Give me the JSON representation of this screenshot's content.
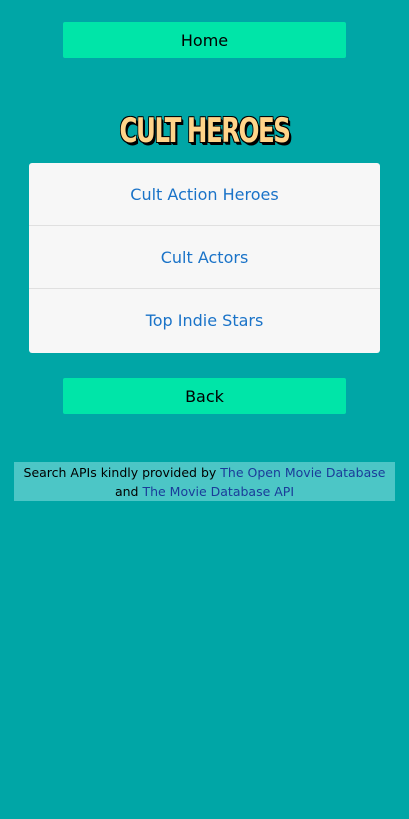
{
  "nav": {
    "home_label": "Home",
    "back_label": "Back"
  },
  "page": {
    "title": "CULT HEROES"
  },
  "menu": {
    "items": [
      {
        "label": "Cult Action Heroes"
      },
      {
        "label": "Cult Actors"
      },
      {
        "label": "Top Indie Stars"
      }
    ]
  },
  "footer": {
    "prefix": "Search APIs kindly provided by",
    "link1": "The Open Movie Database",
    "connector": "and",
    "link2": "The Movie Database API"
  },
  "colors": {
    "background": "#00a6a6",
    "button": "#00e5a8",
    "title": "#ffd48a",
    "link": "#1a73c8"
  }
}
